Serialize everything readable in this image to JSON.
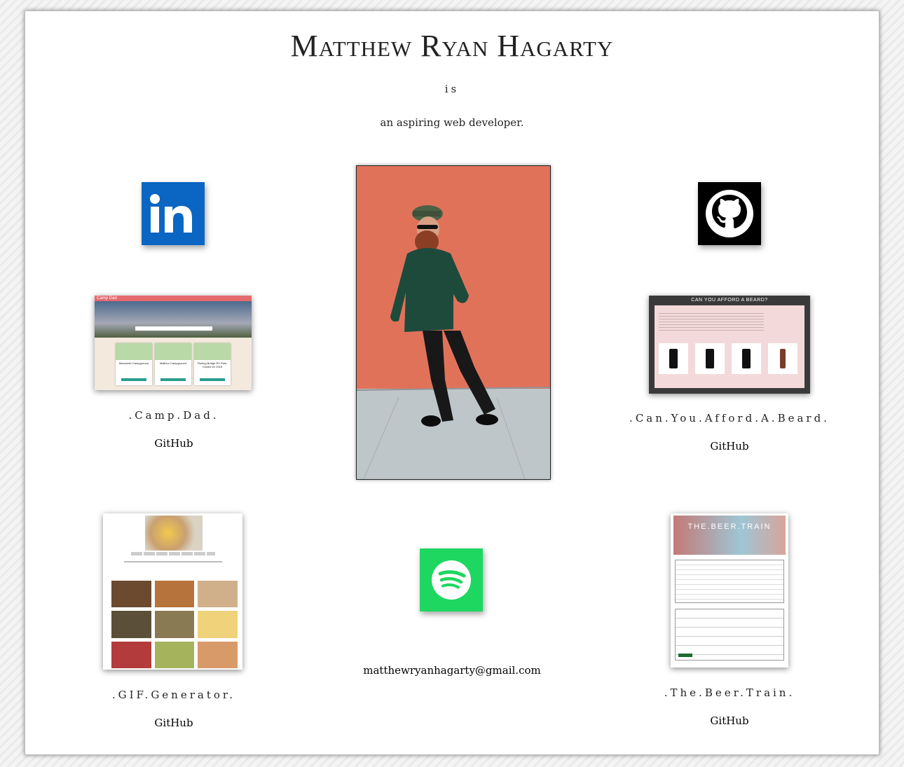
{
  "header": {
    "name": "Matthew Ryan Hagarty",
    "is": "is",
    "tagline": "an aspiring web developer."
  },
  "social": {
    "linkedin_icon": "linkedin-icon",
    "github_icon": "github-icon",
    "spotify_icon": "spotify-icon"
  },
  "projects": [
    {
      "title": ".Camp.Dad.",
      "link": "GitHub",
      "thumb_title": "Camp Dad",
      "cards": [
        "Mammoth Campground",
        "Mailbox Campground",
        "Fishing Bridge RV Park, Closed for 2018"
      ]
    },
    {
      "title": ".Can.You.Afford.A.Beard.",
      "link": "GitHub",
      "thumb_title": "CAN YOU AFFORD A BEARD?"
    },
    {
      "title": ".GIF.Generator.",
      "link": "GitHub"
    },
    {
      "title": ".The.Beer.Train.",
      "link": "GitHub",
      "thumb_title": "THE.BEER.TRAIN"
    }
  ],
  "contact": {
    "email": "matthewryanhagarty@gmail.com"
  },
  "colors": {
    "linkedin": "#0a66c2",
    "github": "#000000",
    "spotify": "#1ed760"
  }
}
